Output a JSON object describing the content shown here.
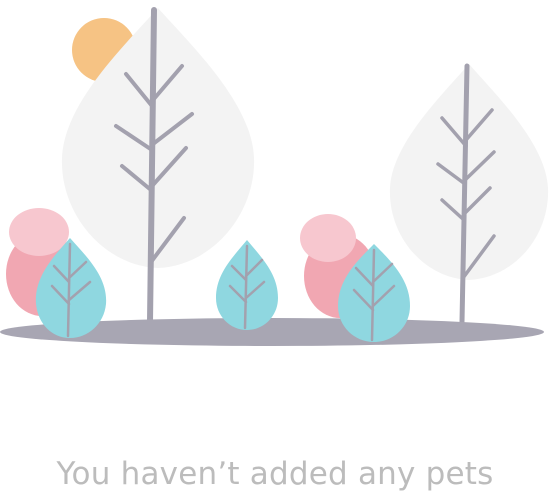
{
  "empty_state": {
    "message": "You haven’t added any pets",
    "illustration": {
      "icon": "empty-forest-illustration",
      "colors": {
        "ground": "#a8a6b3",
        "sun": "#f6c384",
        "big_tree_leaf": "#f3f3f3",
        "tree_trunk": "#a3a1ae",
        "bush_teal": "#8fd7e0",
        "bush_pink": "#f1a7b2",
        "bush_pink_light": "#f7c7cf"
      }
    }
  }
}
